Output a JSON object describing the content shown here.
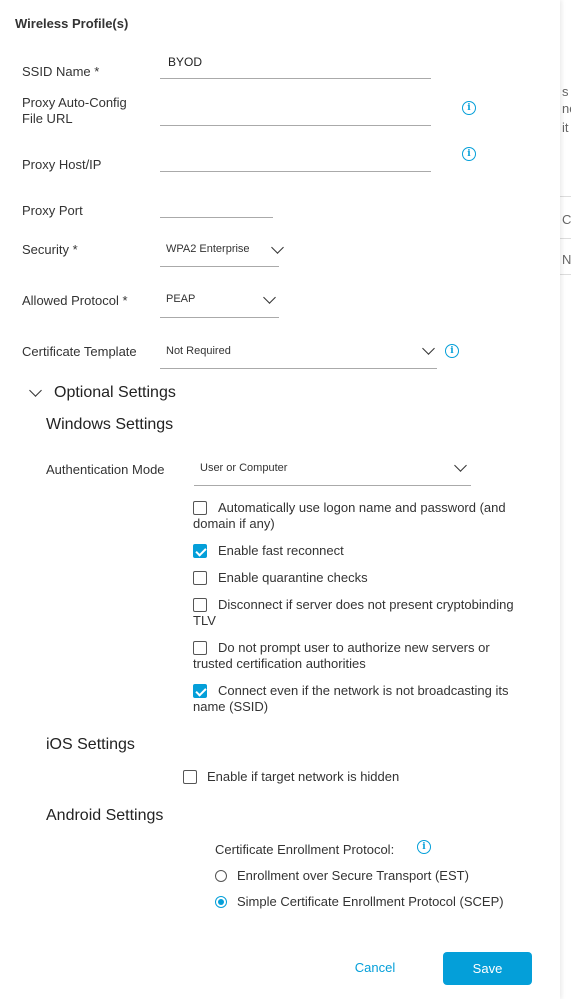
{
  "modal": {
    "title": "Wireless Profile(s)",
    "fields": {
      "ssid_label": "SSID Name *",
      "ssid_value": "BYOD",
      "proxy_url_label_1": "Proxy Auto-Config",
      "proxy_url_label_2": "File URL",
      "proxy_url_value": "",
      "proxy_host_label": "Proxy Host/IP",
      "proxy_host_value": "",
      "proxy_port_label": "Proxy Port",
      "proxy_port_value": "",
      "security_label": "Security *",
      "security_value": "WPA2 Enterprise",
      "protocol_label": "Allowed Protocol *",
      "protocol_value": "PEAP",
      "cert_label": "Certificate Template",
      "cert_value": "Not Required"
    },
    "optional": {
      "title": "Optional Settings",
      "windows": {
        "title": "Windows Settings",
        "auth_label": "Authentication Mode",
        "auth_value": "User or Computer",
        "checks": [
          {
            "line1": "Automatically use logon name and password (and",
            "line2": "domain if any)",
            "checked": false
          },
          {
            "line1": "Enable fast reconnect",
            "line2": "",
            "checked": true
          },
          {
            "line1": "Enable quarantine checks",
            "line2": "",
            "checked": false
          },
          {
            "line1": "Disconnect if server does not present cryptobinding",
            "line2": "TLV",
            "checked": false
          },
          {
            "line1": "Do not prompt user to authorize new servers or",
            "line2": "trusted certification authorities",
            "checked": false
          },
          {
            "line1": "Connect even if the network is not broadcasting its",
            "line2": "name (SSID)",
            "checked": true
          }
        ]
      },
      "ios": {
        "title": "iOS Settings",
        "hidden_label": "Enable if target network is hidden",
        "hidden_checked": false
      },
      "android": {
        "title": "Android Settings",
        "protocol_label": "Certificate Enrollment Protocol:",
        "options": [
          {
            "label": "Enrollment over Secure Transport (EST)",
            "selected": false
          },
          {
            "label": "Simple Certificate Enrollment Protocol (SCEP)",
            "selected": true
          }
        ]
      }
    },
    "footer": {
      "cancel": "Cancel",
      "save": "Save"
    }
  },
  "background": {
    "frag_1": "s",
    "frag_2": "no",
    "frag_3": "it",
    "frag_4": "Co",
    "frag_5": "N"
  },
  "colors": {
    "accent": "#049fd9"
  }
}
